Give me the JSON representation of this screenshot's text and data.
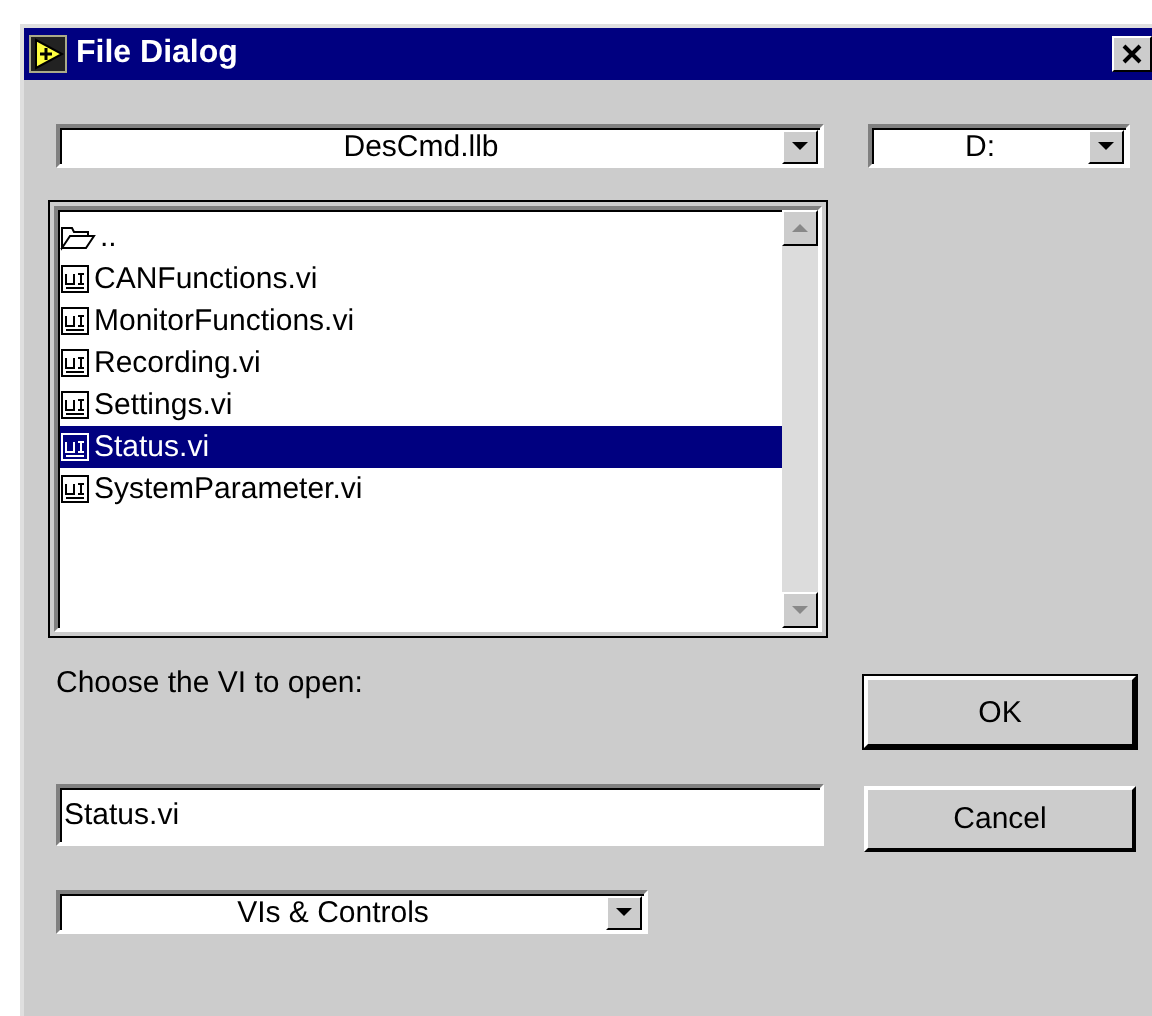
{
  "window": {
    "title": "File Dialog"
  },
  "path_dropdown": {
    "value": "DesCmd.llb"
  },
  "drive_dropdown": {
    "value": "D:"
  },
  "files": [
    {
      "kind": "folder",
      "name": "..",
      "selected": false
    },
    {
      "kind": "vi",
      "name": "CANFunctions.vi",
      "selected": false
    },
    {
      "kind": "vi",
      "name": "MonitorFunctions.vi",
      "selected": false
    },
    {
      "kind": "vi",
      "name": "Recording.vi",
      "selected": false
    },
    {
      "kind": "vi",
      "name": "Settings.vi",
      "selected": false
    },
    {
      "kind": "vi",
      "name": "Status.vi",
      "selected": true
    },
    {
      "kind": "vi",
      "name": "SystemParameter.vi",
      "selected": false
    }
  ],
  "prompt": "Choose the VI to open:",
  "filename_field": {
    "value": "Status.vi"
  },
  "filter_dropdown": {
    "value": "VIs & Controls"
  },
  "buttons": [
    {
      "label": "OK"
    },
    {
      "label": "Cancel"
    }
  ]
}
